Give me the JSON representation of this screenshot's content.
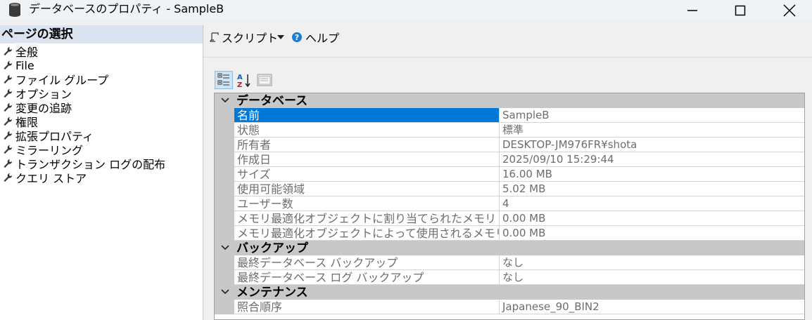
{
  "window": {
    "title": "データベースのプロパティ - SampleB",
    "icon": "database-icon"
  },
  "left_panel": {
    "header": "ページの選択",
    "items": [
      {
        "label": "全般",
        "icon": "wrench-icon",
        "selected": true
      },
      {
        "label": "File",
        "icon": "wrench-icon"
      },
      {
        "label": "ファイル グループ",
        "icon": "wrench-icon"
      },
      {
        "label": "オプション",
        "icon": "wrench-icon"
      },
      {
        "label": "変更の追跡",
        "icon": "wrench-icon"
      },
      {
        "label": "権限",
        "icon": "wrench-icon"
      },
      {
        "label": "拡張プロパティ",
        "icon": "wrench-icon"
      },
      {
        "label": "ミラーリング",
        "icon": "wrench-icon"
      },
      {
        "label": "トランザクション ログの配布",
        "icon": "wrench-icon"
      },
      {
        "label": "クエリ ストア",
        "icon": "wrench-icon"
      }
    ]
  },
  "toolbar": {
    "script_label": "スクリプト",
    "help_label": "ヘルプ"
  },
  "property_grid": {
    "categories": [
      {
        "label": "データベース",
        "rows": [
          {
            "name": "名前",
            "value": "SampleB",
            "selected": true
          },
          {
            "name": "状態",
            "value": "標準"
          },
          {
            "name": "所有者",
            "value": "DESKTOP-JM976FR¥shota"
          },
          {
            "name": "作成日",
            "value": "2025/09/10 15:29:44"
          },
          {
            "name": "サイズ",
            "value": "16.00 MB"
          },
          {
            "name": "使用可能領域",
            "value": "5.02 MB"
          },
          {
            "name": "ユーザー数",
            "value": "4"
          },
          {
            "name": "メモリ最適化オブジェクトに割り当てられたメモリ",
            "value": "0.00 MB"
          },
          {
            "name": "メモリ最適化オブジェクトによって使用されるメモリ",
            "value": "0.00 MB"
          }
        ]
      },
      {
        "label": "バックアップ",
        "rows": [
          {
            "name": "最終データベース バックアップ",
            "value": "なし"
          },
          {
            "name": "最終データベース ログ バックアップ",
            "value": "なし"
          }
        ]
      },
      {
        "label": "メンテナンス",
        "rows": [
          {
            "name": "照合順序",
            "value": "Japanese_90_BIN2"
          }
        ]
      }
    ]
  },
  "colors": {
    "selection": "#0078d7",
    "category_bg": "#c8c8c8",
    "left_header_bg": "#d9e4f0",
    "help_icon": "#1a7fd4"
  }
}
